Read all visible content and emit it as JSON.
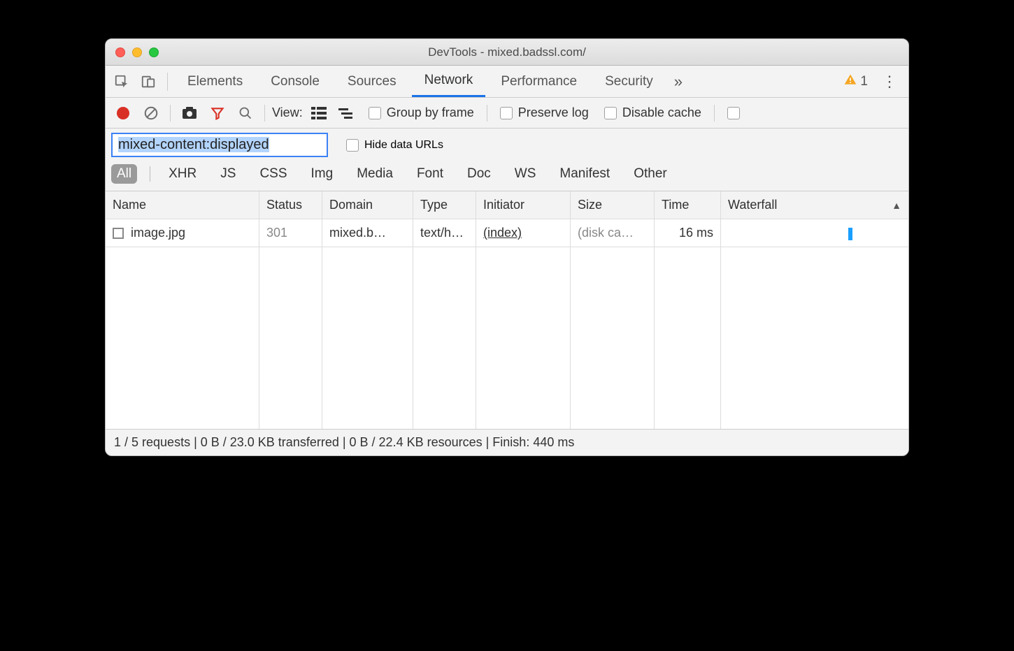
{
  "window": {
    "title": "DevTools - mixed.badssl.com/"
  },
  "tabs": {
    "items": [
      "Elements",
      "Console",
      "Sources",
      "Network",
      "Performance",
      "Security"
    ],
    "active": "Network"
  },
  "warnings": {
    "count": "1"
  },
  "toolbar": {
    "view_label": "View:",
    "group_by_frame": "Group by frame",
    "preserve_log": "Preserve log",
    "disable_cache": "Disable cache"
  },
  "filter": {
    "value": "mixed-content:displayed",
    "hide_data_urls": "Hide data URLs",
    "pills": [
      "All",
      "XHR",
      "JS",
      "CSS",
      "Img",
      "Media",
      "Font",
      "Doc",
      "WS",
      "Manifest",
      "Other"
    ],
    "active_pill": "All"
  },
  "columns": {
    "name": "Name",
    "status": "Status",
    "domain": "Domain",
    "type": "Type",
    "initiator": "Initiator",
    "size": "Size",
    "time": "Time",
    "waterfall": "Waterfall"
  },
  "rows": [
    {
      "name": "image.jpg",
      "status": "301",
      "domain": "mixed.b…",
      "type": "text/h…",
      "initiator": "(index)",
      "size": "(disk ca…",
      "time": "16 ms"
    }
  ],
  "statusbar": {
    "text": "1 / 5 requests | 0 B / 23.0 KB transferred | 0 B / 22.4 KB resources | Finish: 440 ms"
  }
}
